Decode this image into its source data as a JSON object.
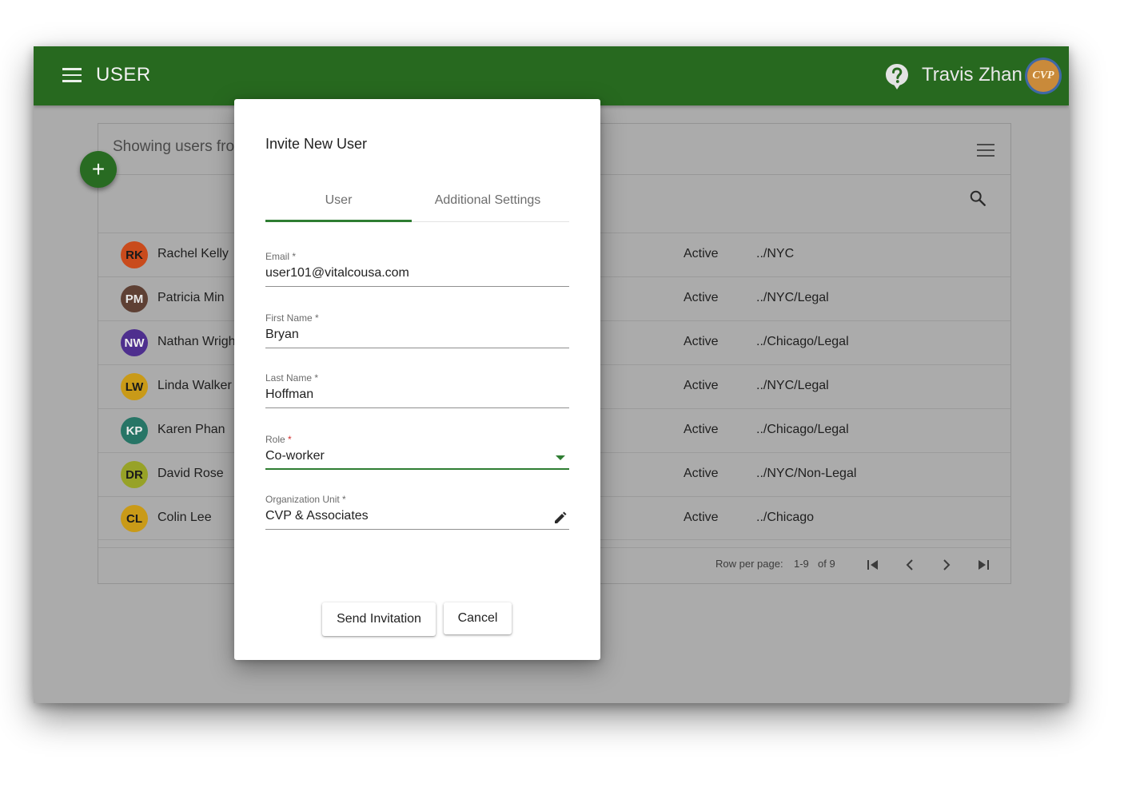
{
  "appbar": {
    "title": "USER",
    "user_name": "Travis Zhan",
    "logo_text": "CVP",
    "color": "#27691f"
  },
  "panel": {
    "caption": "Showing users fro",
    "rows": [
      {
        "initials": "RK",
        "name": "Rachel Kelly",
        "status": "Active",
        "path": "../NYC",
        "color": "#d9501f"
      },
      {
        "initials": "PM",
        "name": "Patricia Min",
        "status": "Active",
        "path": "../NYC/Legal",
        "color": "#6d4a3a"
      },
      {
        "initials": "NW",
        "name": "Nathan Wrigh",
        "status": "Active",
        "path": "../Chicago/Legal",
        "color": "#5b3a9e"
      },
      {
        "initials": "LW",
        "name": "Linda Walker",
        "status": "Active",
        "path": "../NYC/Legal",
        "color": "#d7a11a"
      },
      {
        "initials": "KP",
        "name": "Karen Phan",
        "status": "Active",
        "path": "../Chicago/Legal",
        "color": "#2f8a7a"
      },
      {
        "initials": "DR",
        "name": "David Rose",
        "status": "Active",
        "path": "../NYC/Non-Legal",
        "color": "#a8b32a"
      },
      {
        "initials": "CL",
        "name": "Colin Lee",
        "status": "Active",
        "path": "../Chicago",
        "color": "#d9a21c"
      }
    ],
    "pager": {
      "rows_label": "Row per page:",
      "range": "1-9",
      "total": "of 9"
    }
  },
  "dialog": {
    "title": "Invite New User",
    "tabs": [
      "User",
      "Additional Settings"
    ],
    "active_tab": "User",
    "fields": {
      "email": {
        "label": "Email *",
        "value": "user101@vitalcousa.com"
      },
      "first_name": {
        "label": "First Name *",
        "value": "Bryan"
      },
      "last_name": {
        "label": "Last Name *",
        "value": "Hoffman"
      },
      "role": {
        "label": "Role",
        "required_mark": "*",
        "value": "Co-worker"
      },
      "org_unit": {
        "label": "Organization Unit *",
        "value": "CVP & Associates"
      }
    },
    "buttons": {
      "send": "Send Invitation",
      "cancel": "Cancel"
    },
    "accent": "#2e7d32"
  }
}
